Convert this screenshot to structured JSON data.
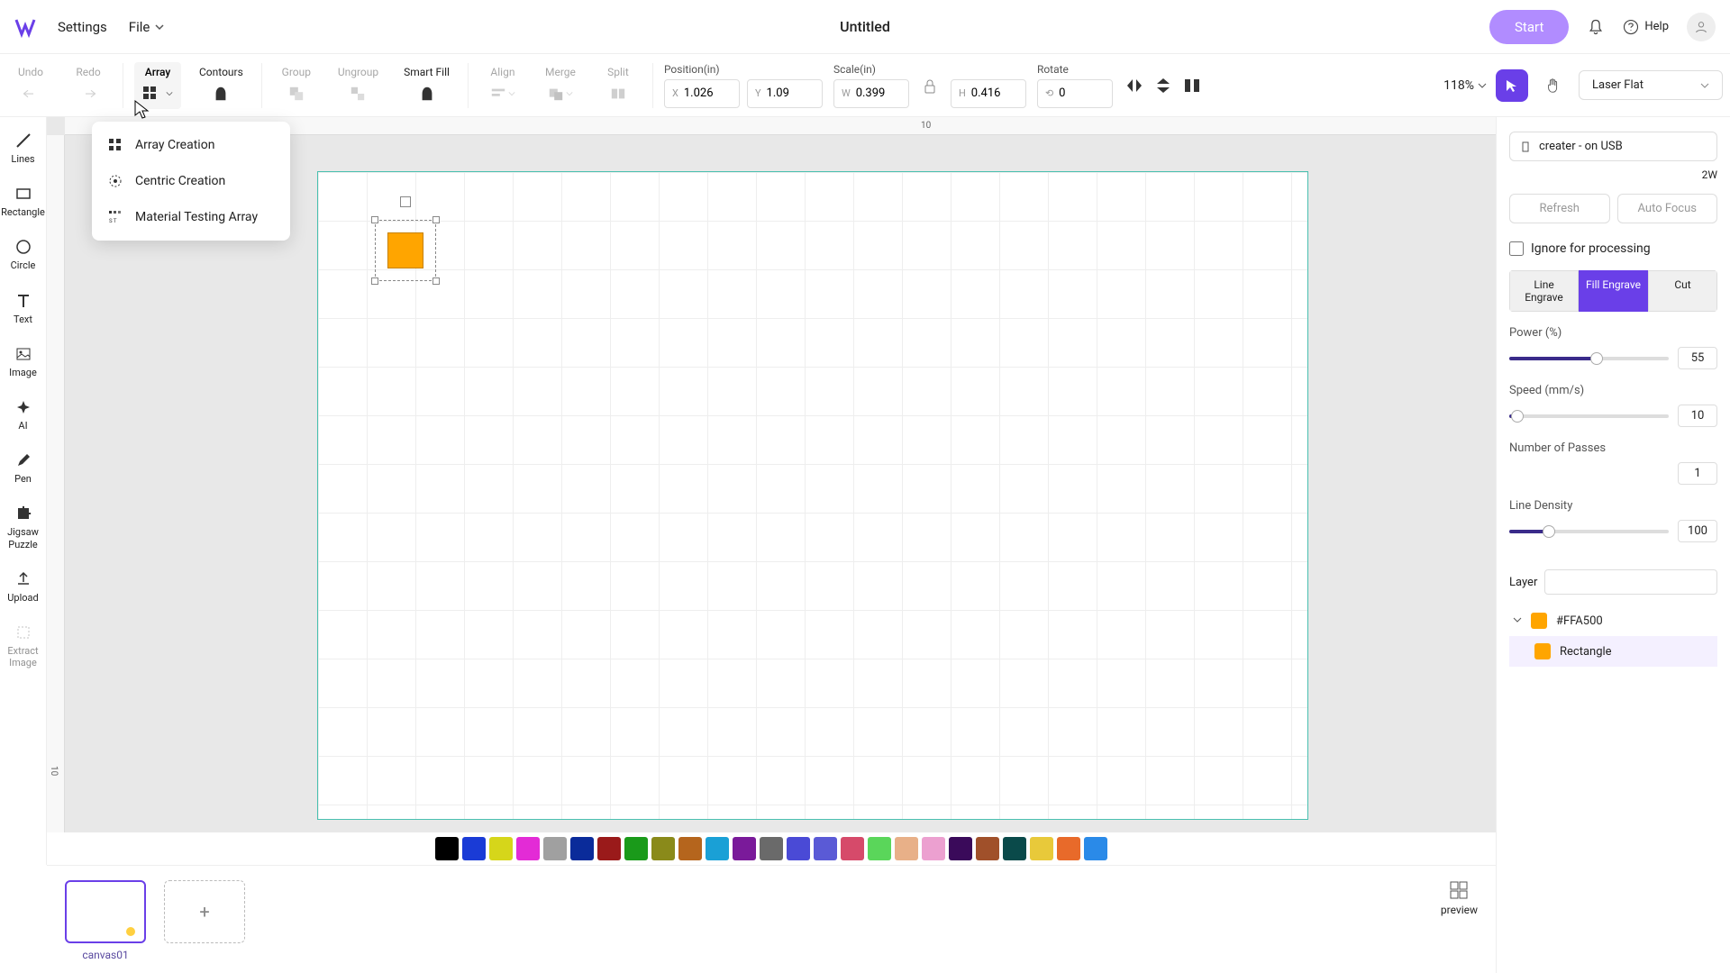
{
  "header": {
    "settings": "Settings",
    "file": "File",
    "title": "Untitled",
    "start": "Start",
    "help": "Help"
  },
  "toolbar": {
    "undo": "Undo",
    "redo": "Redo",
    "array": "Array",
    "contours": "Contours",
    "group": "Group",
    "ungroup": "Ungroup",
    "smartfill": "Smart Fill",
    "align": "Align",
    "merge": "Merge",
    "split": "Split",
    "position_label": "Position(in)",
    "pos_x": "1.026",
    "pos_y": "1.09",
    "scale_label": "Scale(in)",
    "scale_w": "0.399",
    "scale_h": "0.416",
    "rotate_label": "Rotate",
    "rotate_val": "0",
    "zoom": "118%",
    "mode": "Laser Flat"
  },
  "sidebar": {
    "lines": "Lines",
    "rectangle": "Rectangle",
    "circle": "Circle",
    "text": "Text",
    "image": "Image",
    "ai": "AI",
    "pen": "Pen",
    "jigsaw": "Jigsaw Puzzle",
    "upload": "Upload",
    "extract": "Extract Image"
  },
  "dropdown": {
    "item1": "Array Creation",
    "item2": "Centric Creation",
    "item3": "Material Testing Array"
  },
  "ruler": {
    "h_tick": "10",
    "v_tick": "10"
  },
  "panel": {
    "device": "creater - on USB",
    "wattage": "2W",
    "refresh": "Refresh",
    "autofocus": "Auto Focus",
    "ignore": "Ignore for processing",
    "tab_line": "Line Engrave",
    "tab_fill": "Fill Engrave",
    "tab_cut": "Cut",
    "power_label": "Power (%)",
    "power_val": "55",
    "speed_label": "Speed (mm/s)",
    "speed_val": "10",
    "passes_label": "Number of Passes",
    "passes_val": "1",
    "density_label": "Line Density",
    "density_val": "100",
    "layer_label": "Layer",
    "layer_color": "#FFA500",
    "layer_shape": "Rectangle"
  },
  "palette": [
    "#000000",
    "#1a3bd6",
    "#d6d61a",
    "#e32bd6",
    "#a0a0a0",
    "#0a2b9a",
    "#9a1a1a",
    "#1a9a1a",
    "#8a8a1a",
    "#b5651d",
    "#1aa0d6",
    "#7a1a9a",
    "#6a6a6a",
    "#4a4ad6",
    "#5a5ad6",
    "#d64a6a",
    "#5ad65a",
    "#e8b088",
    "#eca0d0",
    "#3a0a5a",
    "#a0502a",
    "#0a4a4a",
    "#e8c93a",
    "#e86a2a",
    "#2a8ae8"
  ],
  "bottom": {
    "canvas_name": "canvas01",
    "add": "+",
    "preview": "preview"
  }
}
